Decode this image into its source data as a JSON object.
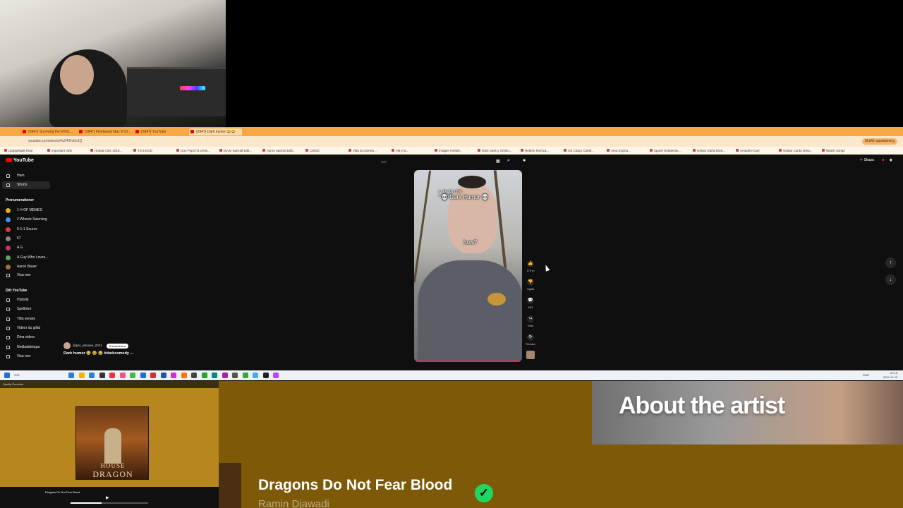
{
  "browser": {
    "tabs": [
      {
        "label": "(2847) Surviving the M7E1..."
      },
      {
        "label": "(2847) Fleetwood Mac 9-10..."
      },
      {
        "label": "(2847) YouTube"
      },
      {
        "label": "(2847) Dark humor 😂😂"
      }
    ],
    "url": "youtube.com/shorts/4xZ4IOvIrb1Q",
    "update_button": "Slutför uppdatering",
    "bookmarks": [
      "Uppspelade listor",
      "Important Vids",
      "Honda Civic 2018...",
      "TS 6-DOD",
      "Gon Pops hit a few...",
      "Dyvio Special Edit...",
      "Aynro Special Edit...",
      "CMOD",
      "Vida la Carrera...",
      "Vid y la...",
      "Imagen Herber...",
      "DSN Sack y Grimlo...",
      "Rebels Tecnica...",
      "GE Cargo Cartel...",
      "Area tropica...",
      "Spotel Gelaterias...",
      "Gelato Darla Drea...",
      "Amadeo-Cary",
      "Gelato Carda Drea...",
      "Watch Songs"
    ]
  },
  "youtube": {
    "logo": "YouTube",
    "search_placeholder": "Sök",
    "create_label": "Skapa",
    "nav": [
      {
        "label": "Hem"
      },
      {
        "label": "Shorts"
      }
    ],
    "subs_heading": "Prenumerationer",
    "subscriptions": [
      {
        "label": "1 H OF MEMES",
        "color": "#e0b020"
      },
      {
        "label": "2 Wheelz Swerving",
        "color": "#4a90e2"
      },
      {
        "label": "9-1-1 Source",
        "color": "#d04040"
      },
      {
        "label": "67",
        "color": "#888888"
      },
      {
        "label": "A G",
        "color": "#c83070"
      },
      {
        "label": "A Guy Who Loves...",
        "color": "#60a060"
      },
      {
        "label": "Aaron Bauer",
        "color": "#a07040"
      }
    ],
    "show_more": "Visa mer",
    "you_heading": "Ditt YouTube",
    "you_items": [
      {
        "label": "Historik"
      },
      {
        "label": "Spellistor"
      },
      {
        "label": "Titta senare"
      },
      {
        "label": "Videor du gillat"
      },
      {
        "label": "Dina videor"
      },
      {
        "label": "Nedladdningar"
      }
    ],
    "show_more2": "Visa mer",
    "short": {
      "caption_small": ">> Daddy drink\n>> How?",
      "caption_main": "💀 Dark Humor 💀",
      "caption_mid": "how?",
      "channel": "@pet_unlovee_2021",
      "subscribe": "Prenumerera",
      "title": "Dark humor 😂 😂 😂 #darkcomedy ..."
    },
    "actions": [
      {
        "icon": "like-icon",
        "count": "179 tn"
      },
      {
        "icon": "dislike-icon",
        "count": "Ogilla"
      },
      {
        "icon": "comment-icon",
        "count": "693"
      },
      {
        "icon": "share-icon",
        "count": "Dela"
      },
      {
        "icon": "remix-icon",
        "count": "Remixa"
      }
    ]
  },
  "taskbar": {
    "search": "Sök",
    "clock_time": "22:18",
    "clock_date": "2024-11-25",
    "locale": "SWE"
  },
  "spotify": {
    "header": "Spotify Premium",
    "album_line1": "HOUSE",
    "album_line2": "DRAGON",
    "now_playing": "Dragons Do Not Fear Blood",
    "progress": 0.4
  },
  "artist_panel": {
    "heading": "About the artist",
    "track_title": "Dragons Do Not Fear Blood",
    "track_artist": "Ramin Djawadi"
  }
}
